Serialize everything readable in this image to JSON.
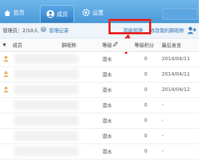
{
  "tabs": [
    {
      "label": "首页",
      "icon": "home-icon"
    },
    {
      "label": "成员",
      "icon": "user-icon"
    },
    {
      "label": "设置",
      "icon": "gear-icon"
    }
  ],
  "info": {
    "admins": "管理员：2/10人",
    "manage_log": "管理记录",
    "advanced_manage": "高级管理",
    "permission": "修改我的群昵称"
  },
  "columns": {
    "member": "成员",
    "nickname": "群昵称",
    "level": "等级",
    "points": "等级积分",
    "last_post": "最后发言"
  },
  "rows": [
    {
      "level": "潜水",
      "points": "0",
      "last": "2014/04/11"
    },
    {
      "level": "潜水",
      "points": "0",
      "last": "2014/04/11"
    },
    {
      "level": "潜水",
      "points": "0",
      "last": "2014/04/12"
    },
    {
      "level": "潜水",
      "points": "0",
      "last": "-"
    },
    {
      "level": "潜水",
      "points": "0",
      "last": "-"
    },
    {
      "level": "潜水",
      "points": "0",
      "last": "-"
    },
    {
      "level": "潜水",
      "points": "0",
      "last": "-"
    }
  ],
  "colors": {
    "accent": "#4a9ad8",
    "highlight": "#e8201b",
    "link": "#2a6fb3"
  }
}
